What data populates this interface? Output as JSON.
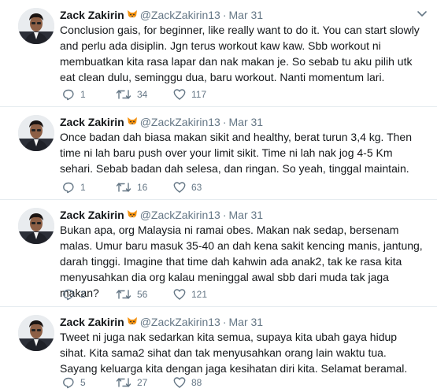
{
  "tweets": [
    {
      "name": "Zack Zakirin",
      "handle": "@ZackZakirin13",
      "separator": "·",
      "date": "Mar 31",
      "text": "Conclusion gais, for beginner, like really want to do it. You can start slowly and perlu ada disiplin. Jgn terus workout kaw kaw. Sbb workout ni membuatkan kita rasa lapar dan nak makan je. So sebab tu aku pilih utk eat clean dulu, seminggu dua, baru workout. Nanti momentum lari.",
      "replies": "1",
      "retweets": "34",
      "likes": "117"
    },
    {
      "name": "Zack Zakirin",
      "handle": "@ZackZakirin13",
      "separator": "·",
      "date": "Mar 31",
      "text": "Once badan dah biasa makan sikit and healthy, berat turun 3,4 kg. Then time ni lah baru push over your limit sikit. Time ni lah nak jog 4-5 Km sehari. Sebab badan dah selesa, dan ringan. So yeah, tinggal maintain.",
      "replies": "1",
      "retweets": "16",
      "likes": "63"
    },
    {
      "name": "Zack Zakirin",
      "handle": "@ZackZakirin13",
      "separator": "·",
      "date": "Mar 31",
      "text": "Bukan apa, org Malaysia ni ramai obes. Makan nak sedap, bersenam malas. Umur baru masuk 35-40 an dah kena sakit kencing manis, jantung, darah tinggi. Imagine that time dah kahwin ada anak2, tak ke rasa kita menyusahkan dia org kalau meninggal awal sbb dari muda tak jaga makan?",
      "replies": "2",
      "retweets": "56",
      "likes": "121"
    },
    {
      "name": "Zack Zakirin",
      "handle": "@ZackZakirin13",
      "separator": "·",
      "date": "Mar 31",
      "text": "Tweet ni juga nak sedarkan kita semua, supaya kita ubah gaya hidup sihat. Kita sama2 sihat dan tak menyusahkan orang lain waktu tua. Sayang keluarga kita dengan jaga kesihatan diri kita. Selamat beramal.",
      "replies": "5",
      "retweets": "27",
      "likes": "88"
    }
  ],
  "icons": {
    "emoji": "fox-face-emoji",
    "reply": "reply-icon",
    "retweet": "retweet-icon",
    "like": "heart-icon",
    "menu": "chevron-down-icon"
  },
  "colors": {
    "text": "#14171a",
    "secondary": "#657786",
    "divider": "#e6ecf0",
    "emoji": "#f4900c"
  }
}
